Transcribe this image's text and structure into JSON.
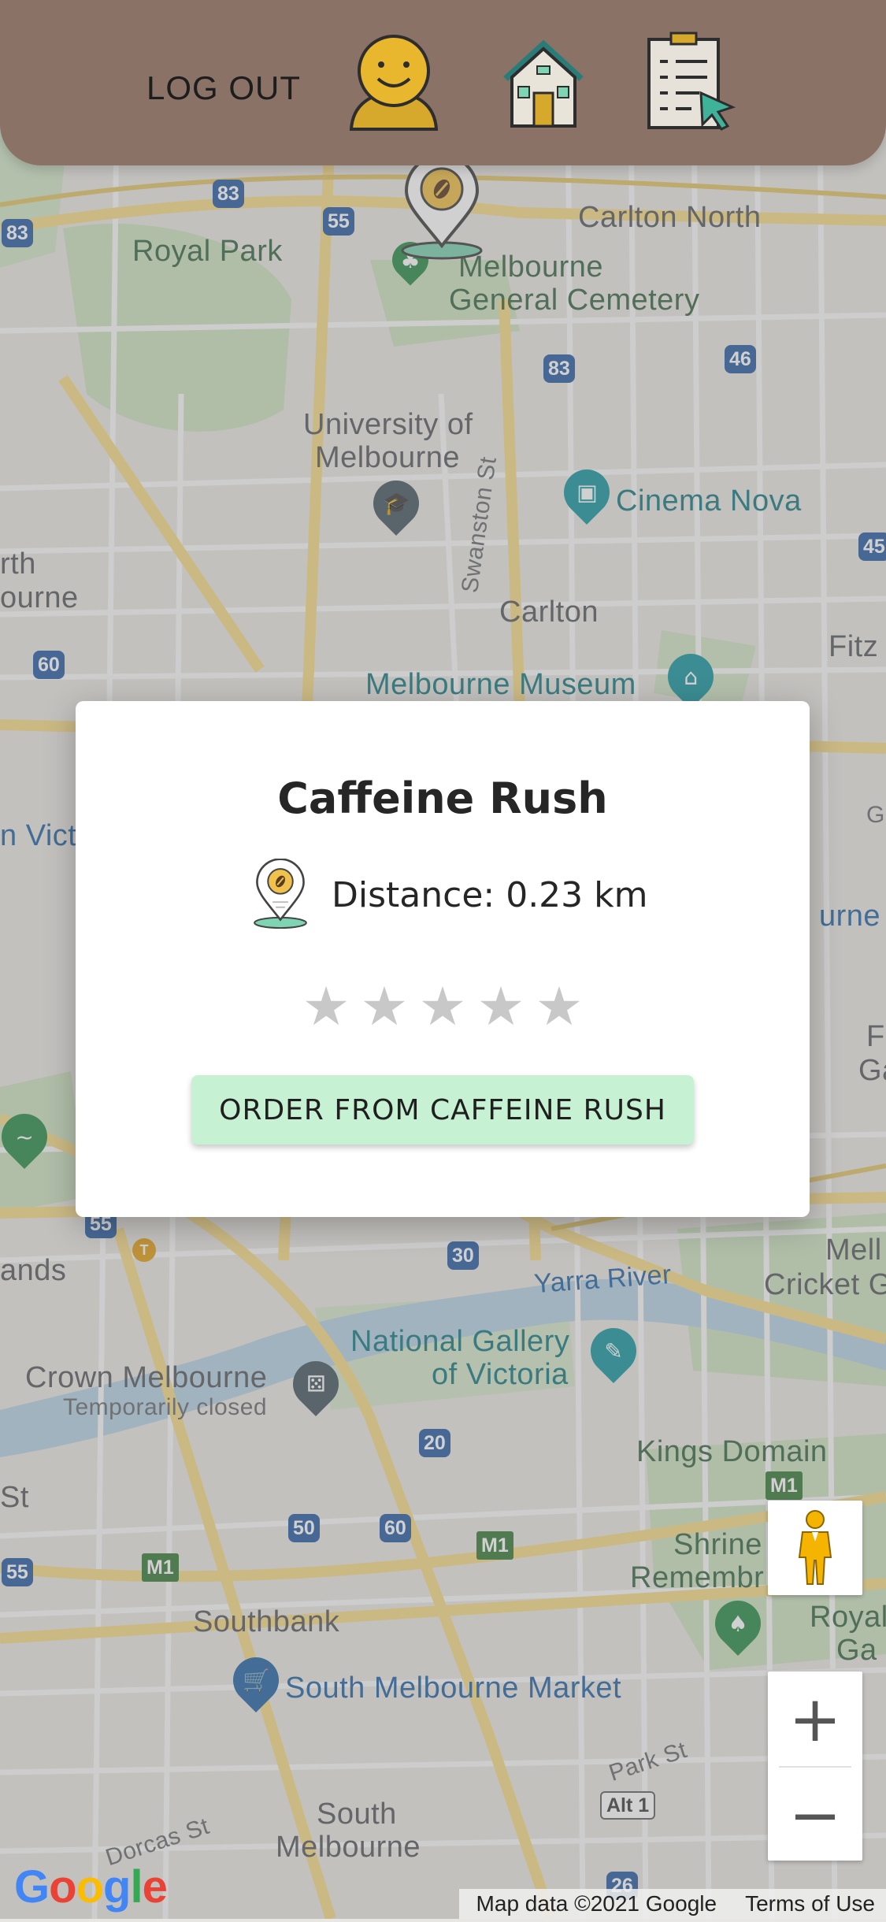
{
  "header": {
    "logout_label": "LOG OUT",
    "icons": [
      "profile-face-icon",
      "home-store-icon",
      "order-list-icon"
    ]
  },
  "map": {
    "labels": {
      "carlton_north": "Carlton North",
      "royal_park": "Royal Park",
      "cemetery_line1": "Melbourne",
      "cemetery_line2": "General Cemetery",
      "uni_line1": "University of",
      "uni_line2": "Melbourne",
      "cinema_nova": "Cinema Nova",
      "swanston": "Swanston St",
      "carlton": "Carlton",
      "north_melb_1": "rth",
      "north_melb_2": "ourne",
      "museum": "Melbourne Museum",
      "fitz": "Fitz",
      "n_vic": "n Vict",
      "urne_right": "urne",
      "ands": "ands",
      "mell_1": "Mell",
      "mell_2": "Cricket G",
      "yarra": "Yarra River",
      "ngv_1": "National Gallery",
      "ngv_2": "of Victoria",
      "crown": "Crown Melbourne",
      "crown_status": "Temporarily closed",
      "kings": "Kings Domain",
      "shrine_1": "Shrine",
      "shrine_2": "Remembr",
      "royal_1": "Royal",
      "royal_2": "Ga",
      "southbank": "Southbank",
      "smm": "South Melbourne Market",
      "park_st": "Park St",
      "south_melb_1": "South",
      "south_melb_2": "Melbourne",
      "dorcas": "Dorcas St",
      "st_left": "St",
      "ge_right": "Ge",
      "f_right": "F",
      "ga_right": "Ga"
    },
    "shields": {
      "r83a": "83",
      "r83b": "83",
      "r55": "55",
      "r83c": "83",
      "r46": "46",
      "r45": "45",
      "r60": "60",
      "r55b": "55",
      "r30": "30",
      "r20": "20",
      "r50": "50",
      "r60b": "60",
      "m1a": "M1",
      "m1b": "M1",
      "m1c": "M1",
      "r55c": "55",
      "alt1": "Alt 1",
      "r26": "26",
      "t": "T"
    }
  },
  "store": {
    "name": "Caffeine Rush",
    "distance_text": "Distance: 0.23 km",
    "rating_max": 5,
    "rating": 0,
    "order_button": "ORDER FROM CAFFEINE RUSH"
  },
  "map_controls": {
    "zoom_in": "+",
    "zoom_out": "−",
    "attribution": "Map data ©2021 Google",
    "terms": "Terms of Use",
    "google_logo": [
      "G",
      "o",
      "o",
      "g",
      "l",
      "e"
    ],
    "logo_colors": [
      "#4285F4",
      "#EA4335",
      "#FBBC05",
      "#4285F4",
      "#34A853",
      "#EA4335"
    ]
  },
  "colors": {
    "header_bg": "#8b7266",
    "order_button_bg": "#c6f2d3",
    "star_empty": "#c8c8c8",
    "pin_accent": "#f0c14b",
    "pin_base": "#7fd4b3"
  }
}
